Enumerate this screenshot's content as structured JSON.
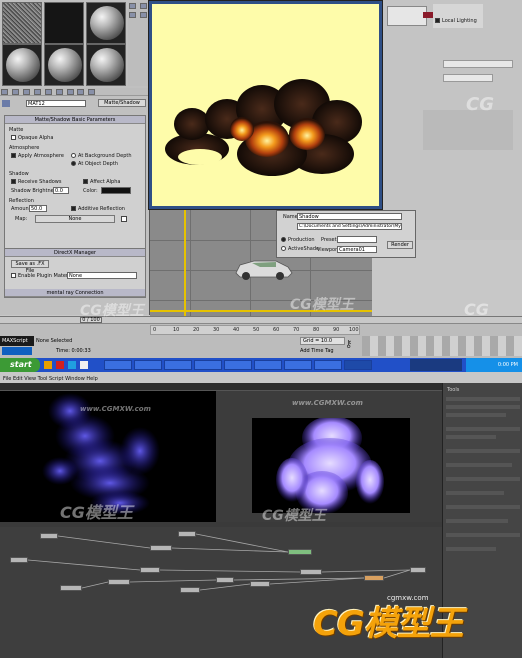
{
  "material_editor": {
    "material_name": "MAT12",
    "material_type": "Matte/Shadow",
    "rollout_title": "Matte/Shadow Basic Parameters",
    "matte_group": "Matte",
    "opaque_alpha": "Opaque Alpha",
    "atmosphere_group": "Atmosphere",
    "apply_atmosphere": "Apply Atmosphere",
    "at_background_depth": "At Background Depth",
    "at_object_depth": "At Object Depth",
    "shadow_group": "Shadow",
    "receive_shadows": "Receive Shadows",
    "affect_alpha": "Affect Alpha",
    "shadow_brightness_label": "Shadow Brightness:",
    "shadow_brightness_value": "0.0",
    "color_label": "Color:",
    "reflection_group": "Reflection",
    "amount_label": "Amount:",
    "amount_value": "50.0",
    "additive_reflection": "Additive Reflection",
    "map_label": "Map:",
    "map_value": "None",
    "directx_title": "DirectX Manager",
    "save_as_fx": "Save as .FX File",
    "enable_plugin": "Enable Plugin Material",
    "plugin_value": "None",
    "mental_ray_connection": "mental ray Connection"
  },
  "render_dialog": {
    "name_label": "Name:",
    "name_value": "Shadow",
    "path_value": "C:\\Documents and Settings\\Administrator\\My Doc",
    "production": "Production",
    "active_shade": "ActiveShade",
    "preset_label": "Preset:",
    "preset_value": "",
    "viewport_label": "Viewport:",
    "viewport_value": "Camera01",
    "render_button": "Render"
  },
  "right_panel": {
    "lighting_label": "Local Lighting"
  },
  "timeline": {
    "frame_label": "0 / 100",
    "ticks": [
      "0",
      "10",
      "20",
      "30",
      "40",
      "50",
      "60",
      "70",
      "80",
      "90",
      "100"
    ],
    "status_selected": "None Selected",
    "status_time": "Time: 0:00:33",
    "grid_label": "Grid = 10.0",
    "add_time_tag": "Add Time Tag",
    "script_label": "MAXScript"
  },
  "taskbar": {
    "start": "start",
    "items": [
      "",
      "",
      "",
      "",
      "",
      "",
      "",
      "",
      ""
    ],
    "clock": "0:00 PM"
  },
  "fusion": {
    "menubar": "File  Edit  View  Tool  Script  Window  Help",
    "tool_panel_title": "Tools"
  },
  "watermarks": {
    "cg": "CG",
    "cg_model": "CG模型王",
    "site": "www.CGMXW.com"
  },
  "logo": {
    "text": "CG模型王",
    "url": "cgmxw.com"
  },
  "colors": {
    "render_bg": "#fefcaa",
    "taskbar": "#2150c8",
    "start_button": "#3c9a35",
    "logo": "#f4a20a",
    "fire_particles": "#4a3dff",
    "fire_blob": "#b59cff"
  }
}
